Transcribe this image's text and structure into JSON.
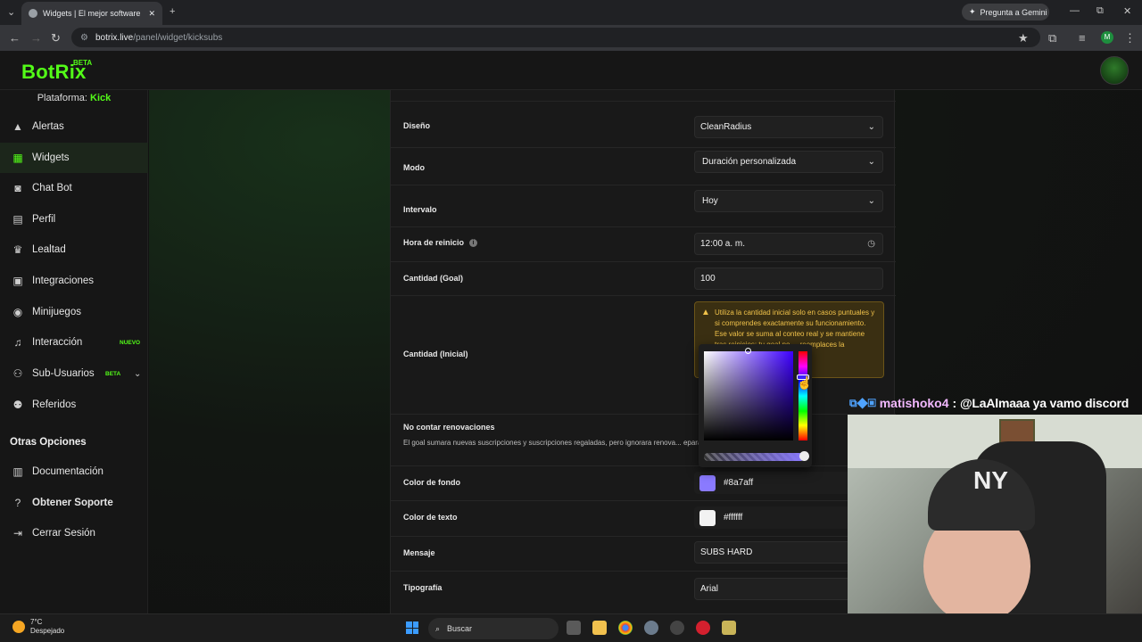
{
  "browser": {
    "tab_title": "Widgets | El mejor software par",
    "tab_close": "✕",
    "new_tab": "+",
    "tab_menu": "⌄",
    "gemini_label": "Pregunta a Gemini",
    "url_host": "botrix.live",
    "url_path": "/panel/widget/kicksubs",
    "profile_initial": "M",
    "win_minimize": "—",
    "win_restore": "⧉",
    "win_close": "✕"
  },
  "app": {
    "logo": "BotRix",
    "logo_badge": "BETA",
    "platform_label": "Plataforma:",
    "platform_value": "Kick"
  },
  "sidebar": {
    "items": [
      {
        "label": "Alertas",
        "icon": "warning-icon"
      },
      {
        "label": "Widgets",
        "icon": "grid-icon"
      },
      {
        "label": "Chat Bot",
        "icon": "robot-icon"
      },
      {
        "label": "Perfil",
        "icon": "id-card-icon"
      },
      {
        "label": "Lealtad",
        "icon": "trophy-icon"
      },
      {
        "label": "Integraciones",
        "icon": "plug-icon"
      },
      {
        "label": "Minijuegos",
        "icon": "gamepad-icon"
      },
      {
        "label": "Interacción",
        "icon": "music-icon",
        "badge": "NUEVO"
      },
      {
        "label": "Sub-Usuarios",
        "icon": "users-icon",
        "badge": "BETA"
      },
      {
        "label": "Referidos",
        "icon": "user-group-icon"
      }
    ],
    "section_title": "Otras Opciones",
    "other_items": [
      {
        "label": "Documentación",
        "icon": "book-icon"
      },
      {
        "label": "Obtener Soporte",
        "icon": "help-icon"
      },
      {
        "label": "Cerrar Sesión",
        "icon": "logout-icon"
      }
    ]
  },
  "form": {
    "diseno_label": "Diseño",
    "diseno_value": "CleanRadius",
    "modo_label": "Modo",
    "modo_value": "Duración personalizada",
    "intervalo_label": "Intervalo",
    "intervalo_value": "Hoy",
    "hora_label": "Hora de reinicio",
    "hora_value": "12:00 a. m.",
    "goal_label": "Cantidad (Goal)",
    "goal_value": "100",
    "inicial_label": "Cantidad (Inicial)",
    "warning_text": "Utiliza la cantidad inicial solo en casos puntuales y si comprendes exactamente su funcionamiento. Ese valor se suma al conteo real y se mantiene tras reinicios; tu goal no ... reemplaces la",
    "renov_label": "No contar renovaciones",
    "renov_desc": "El goal sumara nuevas suscripciones y suscripciones regaladas, pero ignorara renova... eparado p... mezclar historico.",
    "fondo_label": "Color de fondo",
    "fondo_value": "#8a7aff",
    "texto_label": "Color de texto",
    "texto_value": "#ffffff",
    "mensaje_label": "Mensaje",
    "mensaje_value": "SUBS HARD",
    "tipografia_label": "Tipografía",
    "tipografia_value": "Arial"
  },
  "overlay": {
    "chat_user": "matishoko4",
    "chat_sep": ":",
    "chat_msg": "@LaAlmaaa ya vamo discord",
    "cap_logo": "NY"
  },
  "taskbar": {
    "temp": "7°C",
    "weather": "Despejado",
    "search": "Buscar"
  },
  "colors": {
    "accent": "#53fc18",
    "swatch_fondo": "#8a7aff",
    "swatch_texto": "#ffffff",
    "warning": "#f0c24a"
  }
}
